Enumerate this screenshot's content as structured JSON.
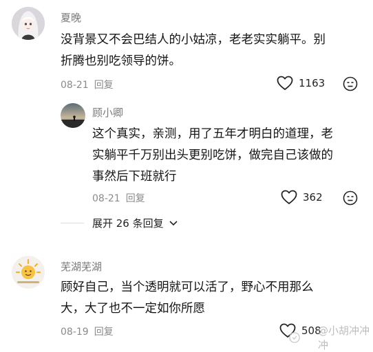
{
  "comments": [
    {
      "author": "夏晚",
      "text_line1": "没背景又不会巴结人的小姑凉，老老实实躺平。别",
      "text_line2": "折腾也别吃领导的饼。",
      "date": "08-21",
      "reply_label": "回复",
      "likes": "1163"
    },
    {
      "author": "顾小卿",
      "text_line1": "这个真实，亲测，用了五年才明白的道理，老",
      "text_line2": "实躺平千万别出头更别吃饼，做完自己该做的",
      "text_line3": "事然后下班就行",
      "date": "08-21",
      "reply_label": "回复",
      "likes": "362"
    },
    {
      "author": "芜湖芜湖",
      "text_line1": "顾好自己，当个透明就可以活了，野心不用那么",
      "text_line2": "大，大了也不一定如你所愿",
      "date": "08-19",
      "reply_label": "回复",
      "likes": "508"
    }
  ],
  "expand_replies": "展开 26 条回复",
  "watermark": "@小胡冲冲冲",
  "icons": {
    "like": "heart-outline-icon",
    "dislike": "unhappy-face-icon",
    "expand": "chevron-down-icon"
  }
}
